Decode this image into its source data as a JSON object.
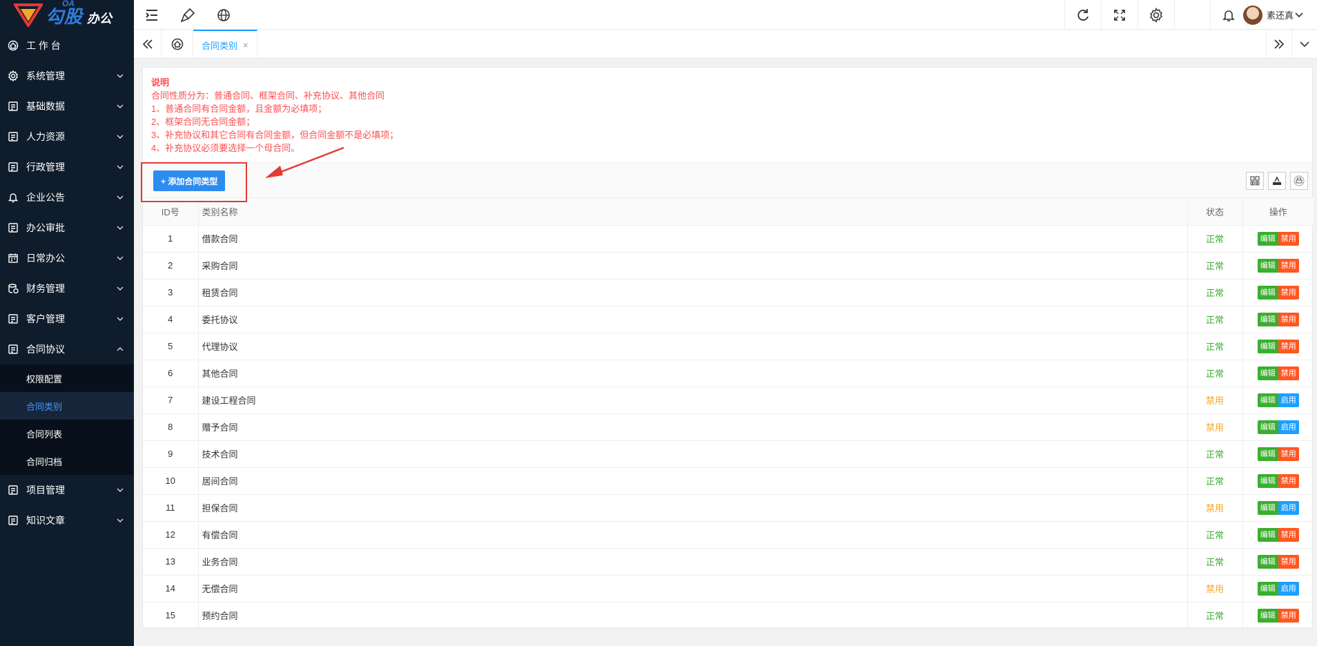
{
  "brand": {
    "oa": "OA",
    "name": "勾股",
    "sub": "办公"
  },
  "sidebar": {
    "items": [
      {
        "label": "工 作 台",
        "icon": "dashboard-icon",
        "expandable": false
      },
      {
        "label": "系统管理",
        "icon": "gear-icon",
        "expandable": true
      },
      {
        "label": "基础数据",
        "icon": "database-icon",
        "expandable": true
      },
      {
        "label": "人力资源",
        "icon": "user-card-icon",
        "expandable": true
      },
      {
        "label": "行政管理",
        "icon": "admin-icon",
        "expandable": true
      },
      {
        "label": "企业公告",
        "icon": "bell-icon",
        "expandable": true
      },
      {
        "label": "办公审批",
        "icon": "approval-icon",
        "expandable": true
      },
      {
        "label": "日常办公",
        "icon": "calendar-icon",
        "expandable": true
      },
      {
        "label": "财务管理",
        "icon": "finance-icon",
        "expandable": true
      },
      {
        "label": "客户管理",
        "icon": "customer-icon",
        "expandable": true
      },
      {
        "label": "合同协议",
        "icon": "contract-icon",
        "expandable": true,
        "open": true
      }
    ],
    "contract_sub": [
      {
        "label": "权限配置",
        "active": false
      },
      {
        "label": "合同类别",
        "active": true
      },
      {
        "label": "合同列表",
        "active": false
      },
      {
        "label": "合同归档",
        "active": false
      }
    ],
    "items_after": [
      {
        "label": "项目管理",
        "icon": "project-icon"
      },
      {
        "label": "知识文章",
        "icon": "article-icon"
      }
    ]
  },
  "header": {
    "user_name": "素还真"
  },
  "tabs": {
    "active_label": "合同类别",
    "close": "×"
  },
  "notice": {
    "title": "说明",
    "lines": [
      "合同性质分为：普通合同、框架合同、补充协议、其他合同",
      "1、普通合同有合同金额，且金额为必填项；",
      "2、框架合同无合同金额；",
      "3、补充协议和其它合同有合同金额，但合同金额不是必填项；",
      "4、补充协议必须要选择一个母合同。"
    ]
  },
  "toolbar": {
    "add_label": "+ 添加合同类型"
  },
  "table": {
    "headers": {
      "id": "ID号",
      "name": "类别名称",
      "status": "状态",
      "ops": "操作"
    },
    "edit_label": "编辑",
    "rows": [
      {
        "id": "1",
        "name": "借款合同",
        "status": "正常",
        "action": "禁用"
      },
      {
        "id": "2",
        "name": "采购合同",
        "status": "正常",
        "action": "禁用"
      },
      {
        "id": "3",
        "name": "租赁合同",
        "status": "正常",
        "action": "禁用"
      },
      {
        "id": "4",
        "name": "委托协议",
        "status": "正常",
        "action": "禁用"
      },
      {
        "id": "5",
        "name": "代理协议",
        "status": "正常",
        "action": "禁用"
      },
      {
        "id": "6",
        "name": "其他合同",
        "status": "正常",
        "action": "禁用"
      },
      {
        "id": "7",
        "name": "建设工程合同",
        "status": "禁用",
        "action": "启用"
      },
      {
        "id": "8",
        "name": "赠予合同",
        "status": "禁用",
        "action": "启用"
      },
      {
        "id": "9",
        "name": "技术合同",
        "status": "正常",
        "action": "禁用"
      },
      {
        "id": "10",
        "name": "居间合同",
        "status": "正常",
        "action": "禁用"
      },
      {
        "id": "11",
        "name": "担保合同",
        "status": "禁用",
        "action": "启用"
      },
      {
        "id": "12",
        "name": "有偿合同",
        "status": "正常",
        "action": "禁用"
      },
      {
        "id": "13",
        "name": "业务合同",
        "status": "正常",
        "action": "禁用"
      },
      {
        "id": "14",
        "name": "无偿合同",
        "status": "禁用",
        "action": "启用"
      },
      {
        "id": "15",
        "name": "预约合同",
        "status": "正常",
        "action": "禁用"
      }
    ]
  },
  "colors": {
    "sidebar_bg": "#0f1c2c",
    "accent": "#1e9fff",
    "ok": "#3bae2f",
    "off": "#f5a623",
    "danger": "#ff5722"
  }
}
